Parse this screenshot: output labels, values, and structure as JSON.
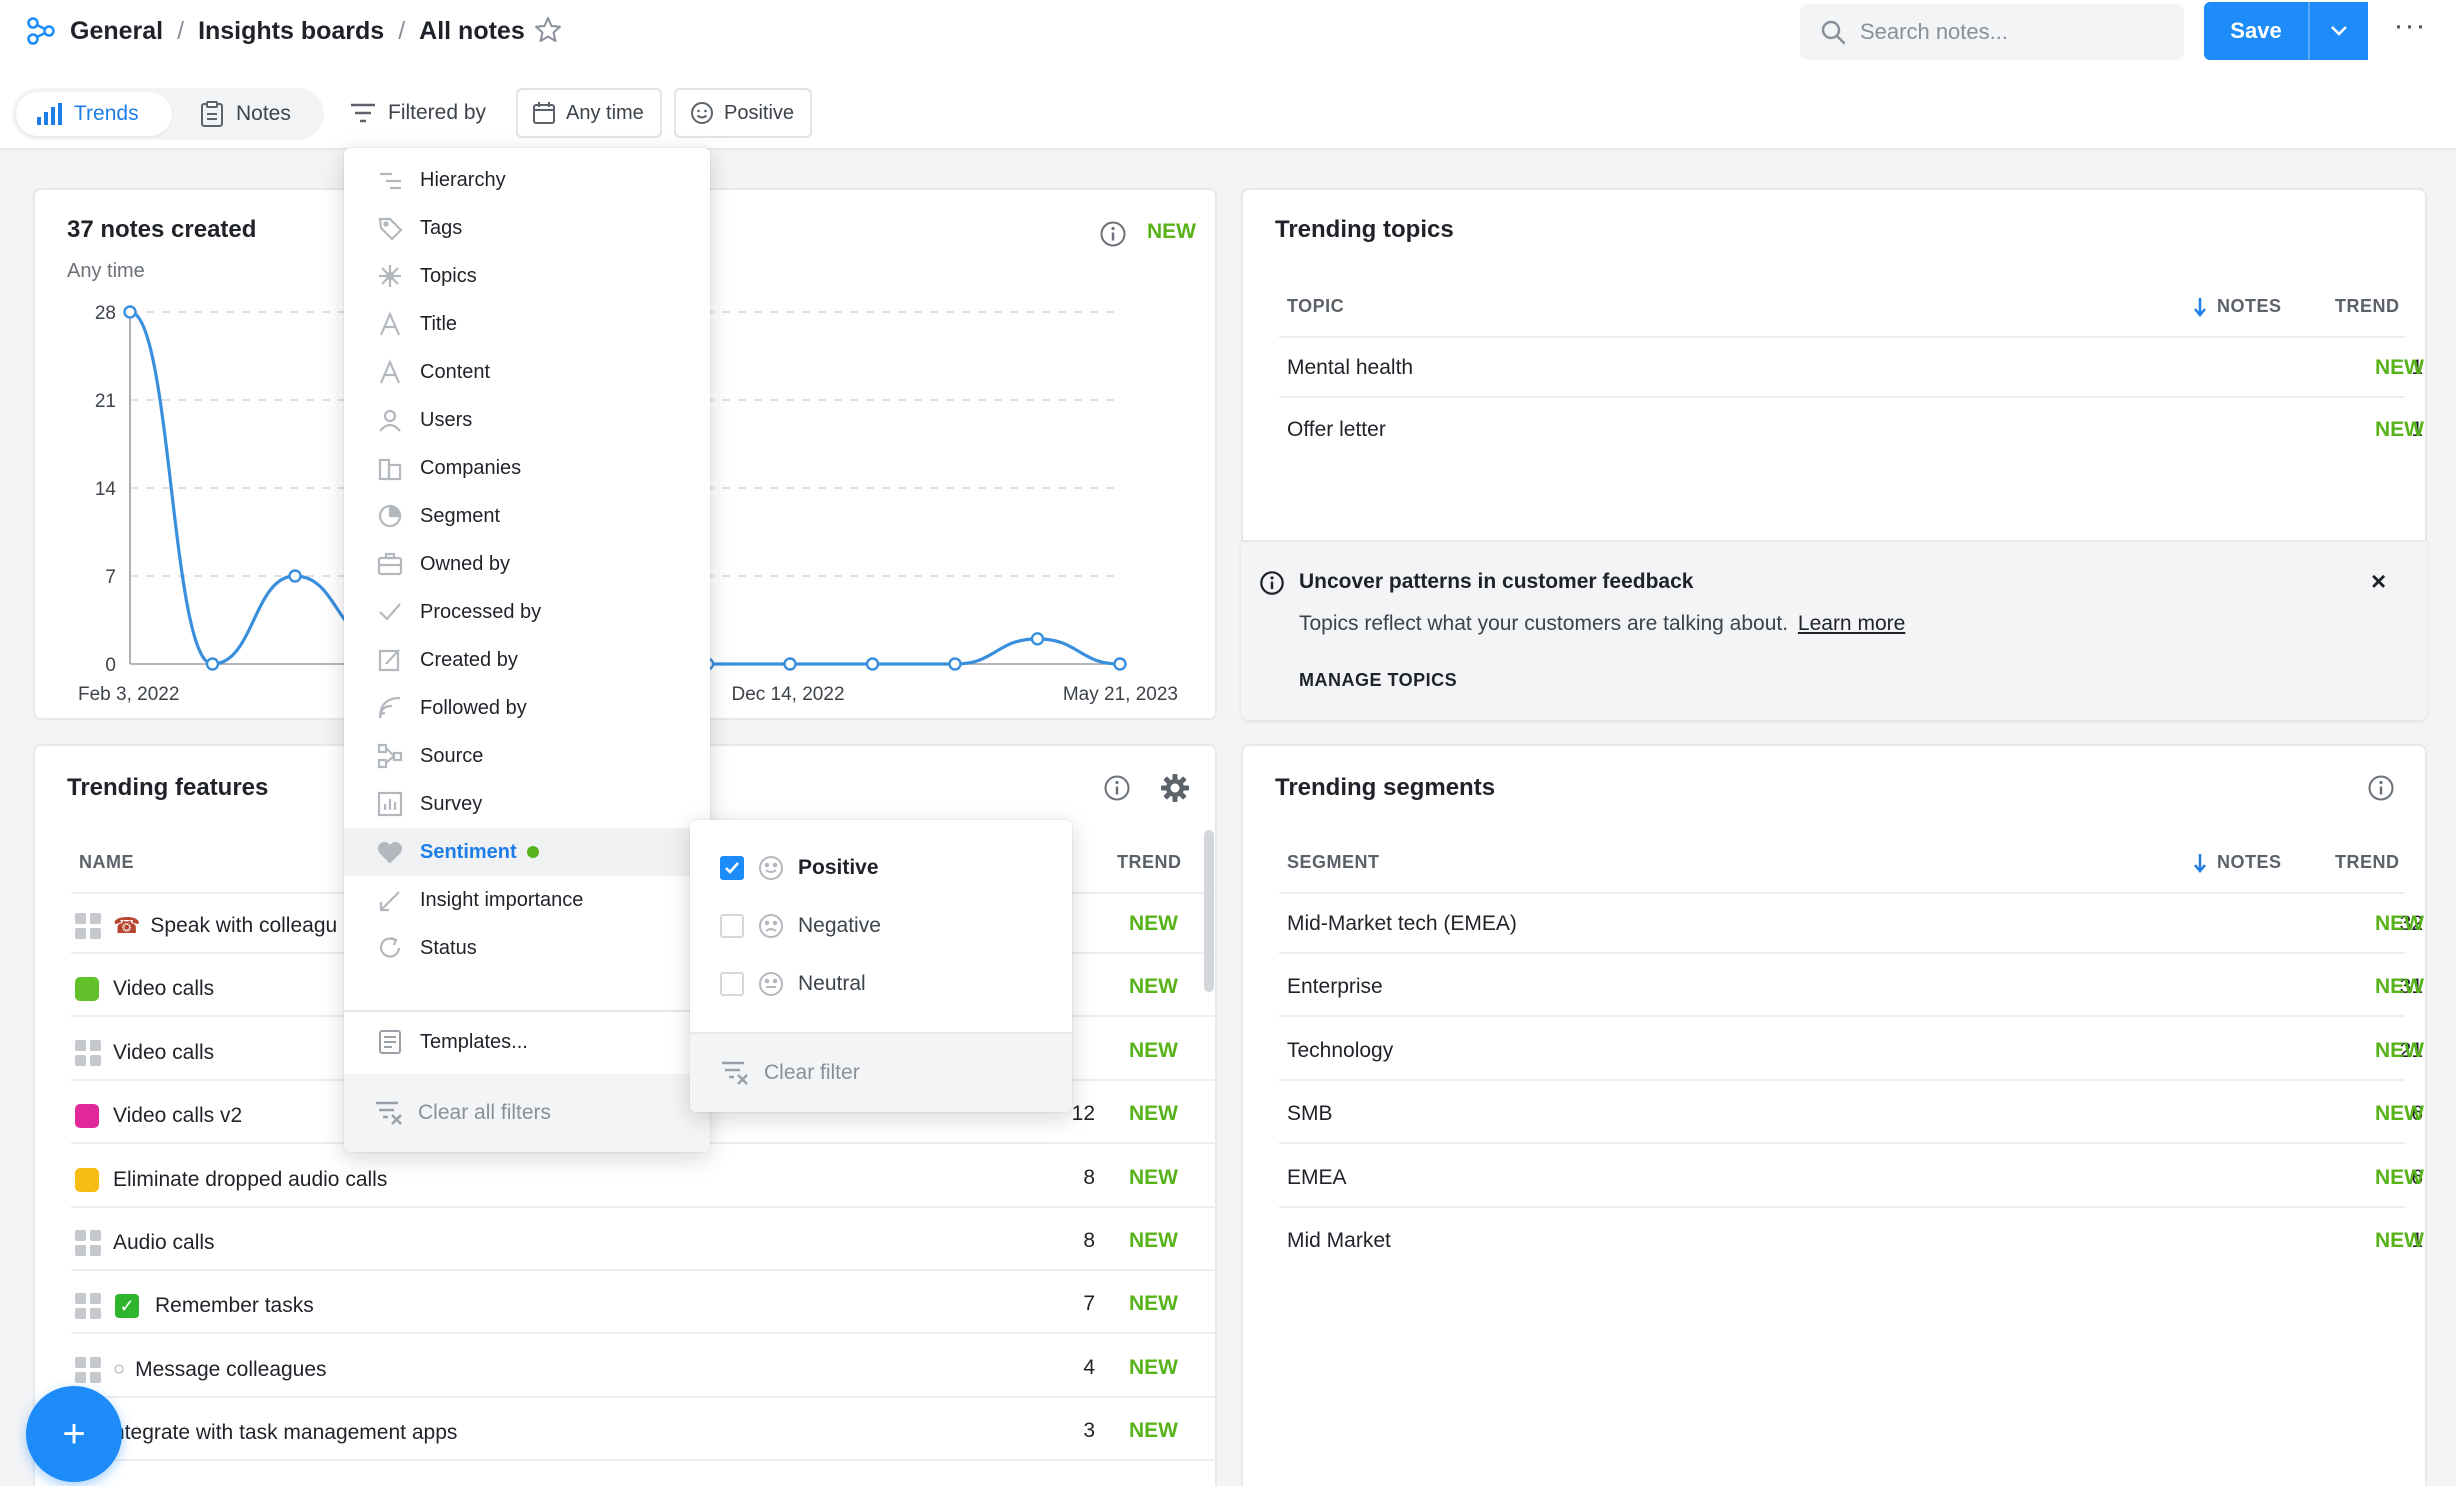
{
  "breadcrumb": {
    "root": "General",
    "parent": "Insights boards",
    "current": "All notes"
  },
  "search": {
    "placeholder": "Search notes..."
  },
  "save": {
    "label": "Save"
  },
  "tabs": [
    {
      "label": "Trends"
    },
    {
      "label": "Notes"
    }
  ],
  "filters": {
    "label": "Filtered by",
    "time_chip": "Any time",
    "sentiment_chip": "Positive"
  },
  "chart_card": {
    "title": "37 notes created",
    "subtitle": "Any time",
    "badge": "NEW"
  },
  "chart_data": {
    "type": "line",
    "title": "37 notes created",
    "subtitle": "Any time",
    "x_tick_labels": [
      "Feb 3, 2022",
      "Dec 14, 2022",
      "May 21, 2023"
    ],
    "y_ticks": [
      0,
      7,
      14,
      21,
      28
    ],
    "ylim": [
      0,
      28
    ],
    "grid": true,
    "x": [
      0,
      1,
      2,
      3,
      4,
      5,
      6,
      7,
      8,
      9,
      10,
      11,
      12
    ],
    "values": [
      28,
      0,
      7,
      2,
      0,
      0,
      0,
      0,
      0,
      0,
      0,
      2,
      0
    ],
    "color": "#3a8fdc"
  },
  "topics": {
    "title": "Trending topics",
    "headers": {
      "topic": "TOPIC",
      "notes": "NOTES",
      "trend": "TREND"
    },
    "rows": [
      {
        "name": "Mental health",
        "notes": "1",
        "trend": "NEW"
      },
      {
        "name": "Offer letter",
        "notes": "1",
        "trend": "NEW"
      }
    ]
  },
  "callout": {
    "title": "Uncover patterns in customer feedback",
    "body": "Topics reflect what your customers are talking about.",
    "link": "Learn more",
    "action": "MANAGE TOPICS"
  },
  "features": {
    "title": "Trending features",
    "headers": {
      "name": "NAME",
      "trend": "TREND"
    },
    "rows": [
      {
        "name": "Speak with colleagu",
        "notes": "",
        "trend": "NEW",
        "icon": "phone-icon"
      },
      {
        "name": "Video calls",
        "notes": "",
        "trend": "NEW",
        "icon": "green-square"
      },
      {
        "name": "Video calls",
        "notes": "",
        "trend": "NEW",
        "icon": "grid"
      },
      {
        "name": "Video calls v2",
        "notes": "12",
        "trend": "NEW",
        "icon": "magenta-square"
      },
      {
        "name": "Eliminate dropped audio calls",
        "notes": "8",
        "trend": "NEW",
        "icon": "yellow-square"
      },
      {
        "name": "Audio calls",
        "notes": "8",
        "trend": "NEW",
        "icon": "grid"
      },
      {
        "name": "Remember tasks",
        "notes": "7",
        "trend": "NEW",
        "icon": "check-icon"
      },
      {
        "name": "Message colleagues",
        "notes": "4",
        "trend": "NEW",
        "icon": "speech-icon"
      },
      {
        "name": "ntegrate with task management apps",
        "notes": "3",
        "trend": "NEW",
        "icon": "grid"
      }
    ]
  },
  "segments": {
    "title": "Trending segments",
    "headers": {
      "segment": "SEGMENT",
      "notes": "NOTES",
      "trend": "TREND"
    },
    "rows": [
      {
        "name": "Mid-Market tech (EMEA)",
        "notes": "32",
        "trend": "NEW"
      },
      {
        "name": "Enterprise",
        "notes": "31",
        "trend": "NEW"
      },
      {
        "name": "Technology",
        "notes": "21",
        "trend": "NEW"
      },
      {
        "name": "SMB",
        "notes": "6",
        "trend": "NEW"
      },
      {
        "name": "EMEA",
        "notes": "6",
        "trend": "NEW"
      },
      {
        "name": "Mid Market",
        "notes": "1",
        "trend": "NEW"
      }
    ]
  },
  "filter_menu": {
    "items": [
      {
        "label": "Hierarchy",
        "icon": "hierarchy-icon"
      },
      {
        "label": "Tags",
        "icon": "tag-icon"
      },
      {
        "label": "Topics",
        "icon": "topics-icon"
      },
      {
        "label": "Title",
        "icon": "text-icon"
      },
      {
        "label": "Content",
        "icon": "text-icon"
      },
      {
        "label": "Users",
        "icon": "user-icon"
      },
      {
        "label": "Companies",
        "icon": "building-icon"
      },
      {
        "label": "Segment",
        "icon": "pie-icon"
      },
      {
        "label": "Owned by",
        "icon": "briefcase-icon"
      },
      {
        "label": "Processed by",
        "icon": "check-icon"
      },
      {
        "label": "Created by",
        "icon": "edit-icon"
      },
      {
        "label": "Followed by",
        "icon": "signal-icon"
      },
      {
        "label": "Source",
        "icon": "source-icon"
      },
      {
        "label": "Survey",
        "icon": "survey-icon"
      },
      {
        "label": "Sentiment",
        "icon": "heart-icon"
      },
      {
        "label": "Insight importance",
        "icon": "importance-icon"
      },
      {
        "label": "Status",
        "icon": "refresh-icon"
      }
    ],
    "templates": "Templates...",
    "clear_all": "Clear all filters"
  },
  "sentiment_menu": {
    "options": [
      {
        "label": "Positive",
        "checked": true
      },
      {
        "label": "Negative",
        "checked": false
      },
      {
        "label": "Neutral",
        "checked": false
      }
    ],
    "clear": "Clear filter"
  },
  "fab": {
    "label": "+"
  },
  "colors": {
    "accent": "#1d8cf8",
    "new_green": "#58b31b"
  }
}
